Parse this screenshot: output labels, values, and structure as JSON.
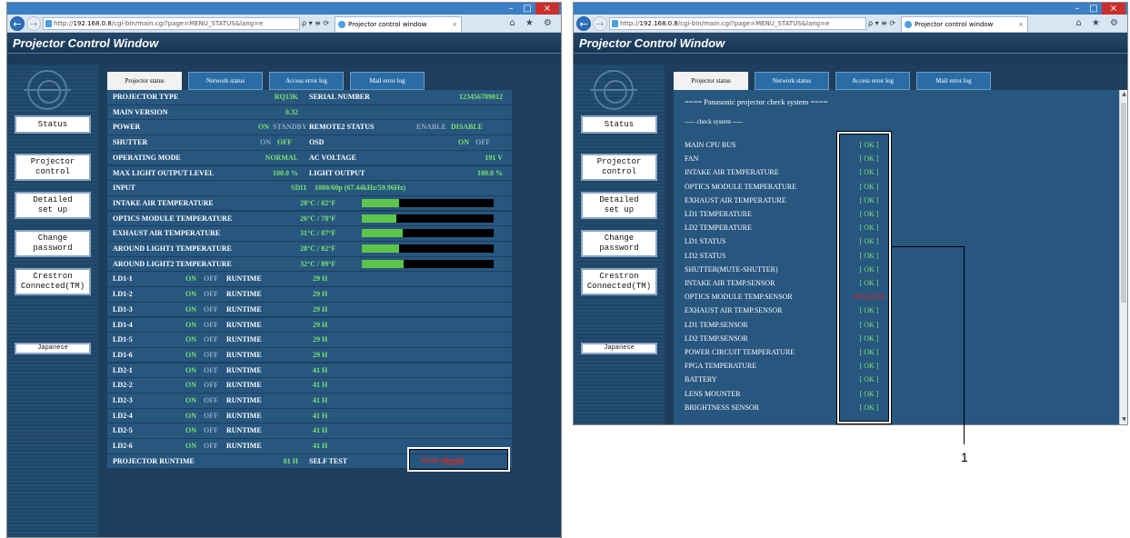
{
  "browser": {
    "url_prefix": "http://",
    "url_host": "192.168.0.8",
    "url_path": "/cgi-bin/main.cgi?page=MENU_STATUS&lang=e",
    "url_tools": "ρ ▾ ≡ ⟳",
    "tab_title": "Projector control window",
    "tab_close": "×",
    "icons": "⌂ ★ ⚙"
  },
  "window_controls": {
    "minimize": "–",
    "maximize": "□",
    "close": "×"
  },
  "nav": {
    "back": "←",
    "forward": "→"
  },
  "app_title": "Projector Control Window",
  "sidebar": {
    "status": "Status",
    "projector_control": "Projector\ncontrol",
    "detailed_setup": "Detailed\nset up",
    "change_password": "Change\npassword",
    "crestron": "Crestron\nConnected(TM)",
    "japanese": "Japanese"
  },
  "tabs": [
    "Projector status",
    "Network status",
    "Access error log",
    "Mail error log"
  ],
  "status": {
    "projector_type_label": "PROJECTOR TYPE",
    "projector_type": "RQ13K",
    "serial_label": "SERIAL NUMBER",
    "serial": "123456789012",
    "main_version_label": "MAIN VERSION",
    "main_version": "0.32",
    "power_label": "POWER",
    "power_on": "ON",
    "power_standby": "STANDBY",
    "remote2_label": "REMOTE2 STATUS",
    "remote2_enable": "ENABLE",
    "remote2_disable": "DISABLE",
    "shutter_label": "SHUTTER",
    "shutter_on": "ON",
    "shutter_off": "OFF",
    "osd_label": "OSD",
    "osd_on": "ON",
    "osd_off": "OFF",
    "opmode_label": "OPERATING MODE",
    "opmode": "NORMAL",
    "acv_label": "AC VOLTAGE",
    "acv": "191 V",
    "maxlight_label": "MAX LIGHT OUTPUT LEVEL",
    "maxlight": "100.0 %",
    "lightout_label": "LIGHT OUTPUT",
    "lightout": "100.0 %",
    "input_label": "INPUT",
    "input": "SDI1",
    "input_signal": "1080/60p (67.44kHz/59.96Hz)",
    "temps": [
      {
        "label": "INTAKE AIR TEMPERATURE",
        "value": "28°C / 82°F",
        "level": 0.28
      },
      {
        "label": "OPTICS MODULE TEMPERATURE",
        "value": "26°C / 78°F",
        "level": 0.26
      },
      {
        "label": "EXHAUST AIR TEMPERATURE",
        "value": "31°C / 87°F",
        "level": 0.31
      },
      {
        "label": "AROUND LIGHT1 TEMPERATURE",
        "value": "28°C / 82°F",
        "level": 0.28
      },
      {
        "label": "AROUND LIGHT2 TEMPERATURE",
        "value": "32°C / 89°F",
        "level": 0.32
      }
    ],
    "ld_on": "ON",
    "ld_off": "OFF",
    "runtime_label": "RUNTIME",
    "lds": [
      {
        "name": "LD1-1",
        "runtime": "29 H"
      },
      {
        "name": "LD1-2",
        "runtime": "29 H"
      },
      {
        "name": "LD1-3",
        "runtime": "29 H"
      },
      {
        "name": "LD1-4",
        "runtime": "29 H"
      },
      {
        "name": "LD1-5",
        "runtime": "29 H"
      },
      {
        "name": "LD1-6",
        "runtime": "29 H"
      },
      {
        "name": "LD2-1",
        "runtime": "41 H"
      },
      {
        "name": "LD2-2",
        "runtime": "41 H"
      },
      {
        "name": "LD2-3",
        "runtime": "41 H"
      },
      {
        "name": "LD2-4",
        "runtime": "41 H"
      },
      {
        "name": "LD2-5",
        "runtime": "41 H"
      },
      {
        "name": "LD2-6",
        "runtime": "41 H"
      }
    ],
    "proj_runtime_label": "PROJECTOR RUNTIME",
    "proj_runtime": "81 H",
    "selftest_label": "SELF TEST",
    "selftest_error": "Error (",
    "selftest_detail": "Detail",
    "selftest_close": ")"
  },
  "check": {
    "heading": "==== Panasonic projector check system ====",
    "subheading": "----- check system -----",
    "items": [
      {
        "name": "MAIN CPU BUS",
        "result": "[ OK ]"
      },
      {
        "name": "FAN",
        "result": "[ OK ]"
      },
      {
        "name": "INTAKE AIR TEMPERATURE",
        "result": "[ OK ]"
      },
      {
        "name": "OPTICS MODULE TEMPERATURE",
        "result": "[ OK ]"
      },
      {
        "name": "EXHAUST AIR TEMPERATURE",
        "result": "[ OK ]"
      },
      {
        "name": "LD1 TEMPERATURE",
        "result": "[ OK ]"
      },
      {
        "name": "LD2 TEMPERATURE",
        "result": "[ OK ]"
      },
      {
        "name": "LD1 STATUS",
        "result": "[ OK ]"
      },
      {
        "name": "LD2 STATUS",
        "result": "[ OK ]"
      },
      {
        "name": "SHUTTER(MUTE-SHUTTER)",
        "result": "[ OK ]"
      },
      {
        "name": "INTAKE AIR TEMP.SENSOR",
        "result": "[ OK ]"
      },
      {
        "name": "OPTICS MODULE TEMP.SENSOR",
        "result": "[FAILED]"
      },
      {
        "name": "EXHAUST AIR TEMP.SENSOR",
        "result": "[ OK ]"
      },
      {
        "name": "LD1 TEMP.SENSOR",
        "result": "[ OK ]"
      },
      {
        "name": "LD2 TEMP.SENSOR",
        "result": "[ OK ]"
      },
      {
        "name": "POWER CIRCUIT TEMPERATURE",
        "result": "[ OK ]"
      },
      {
        "name": "FPGA TEMPERATURE",
        "result": "[ OK ]"
      },
      {
        "name": "BATTERY",
        "result": "[ OK ]"
      },
      {
        "name": "LENS MOUNTER",
        "result": "[ OK ]"
      },
      {
        "name": "BRIGHTNESS SENSOR",
        "result": "[ OK ]"
      }
    ]
  },
  "callout_label": "1",
  "colors": {
    "ok": "#7fe36e",
    "fail": "#e2261e",
    "row": "#27567f",
    "header": "#1e3f5c"
  }
}
